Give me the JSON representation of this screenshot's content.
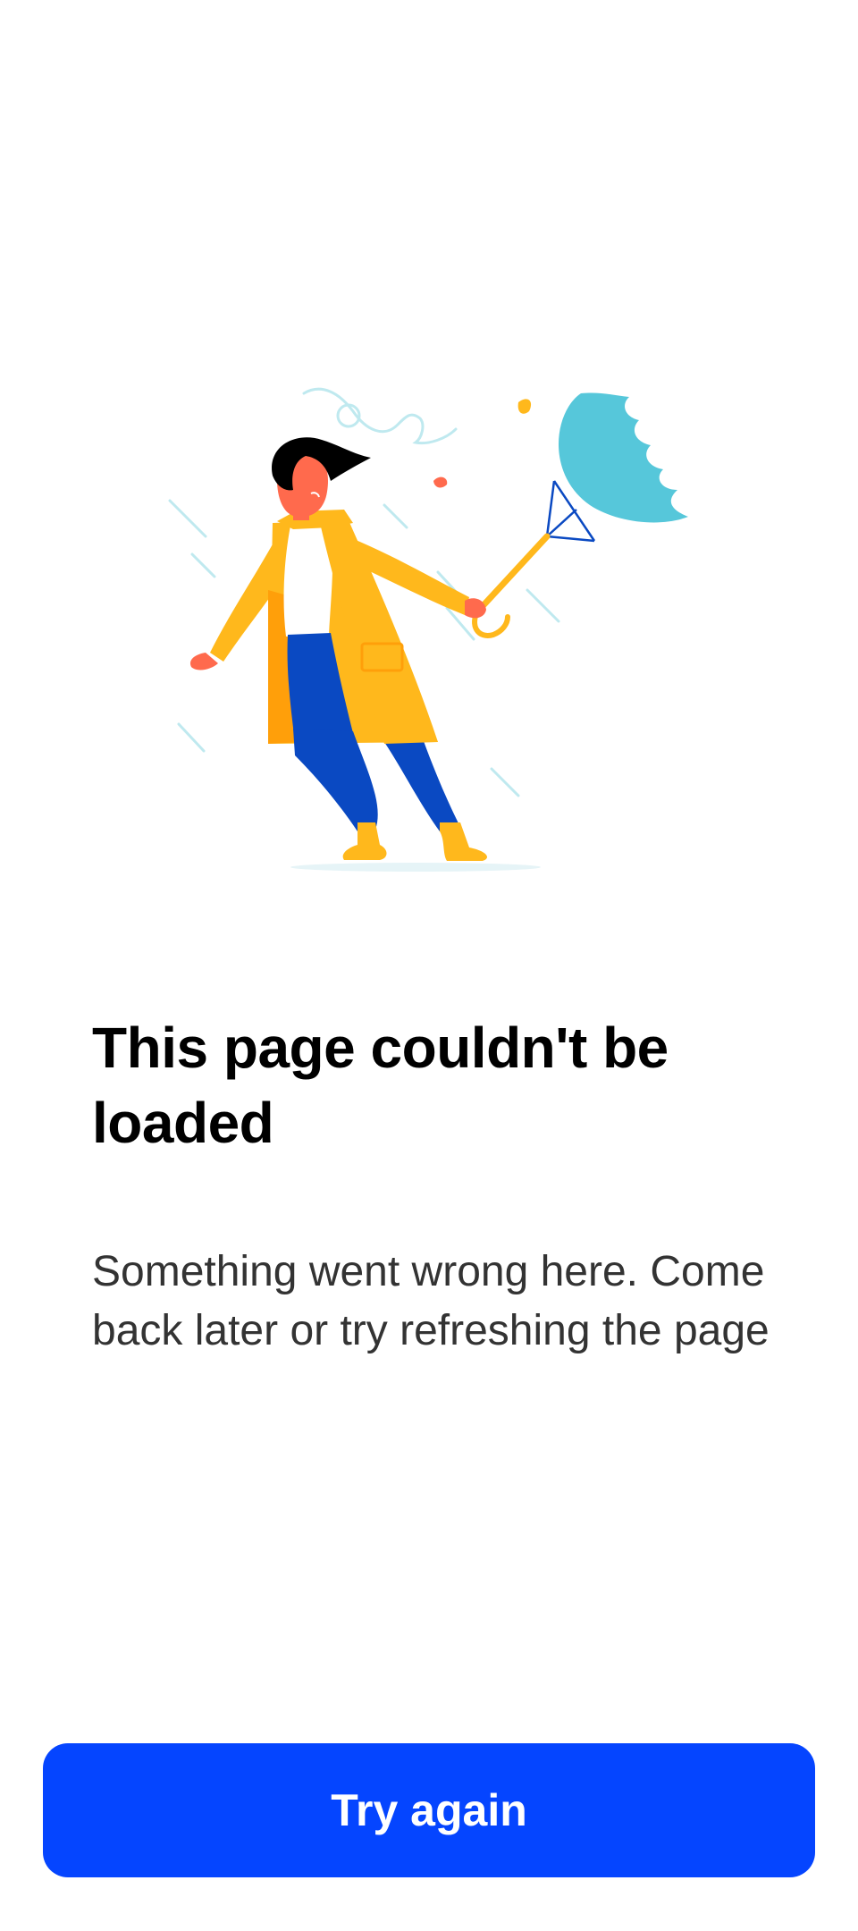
{
  "error": {
    "illustration_icon": "windblown-umbrella-illustration",
    "title": "This page couldn't be loaded",
    "description": "Something went wrong here. Come back later or try refreshing the page"
  },
  "actions": {
    "retry_label": "Try again"
  },
  "colors": {
    "primary_button": "#0545ff",
    "title_text": "#000000",
    "body_text": "#333333",
    "coat": "#ffb81c",
    "pants": "#0a49c2",
    "umbrella": "#56c7da",
    "skin": "#ff6a4d"
  }
}
